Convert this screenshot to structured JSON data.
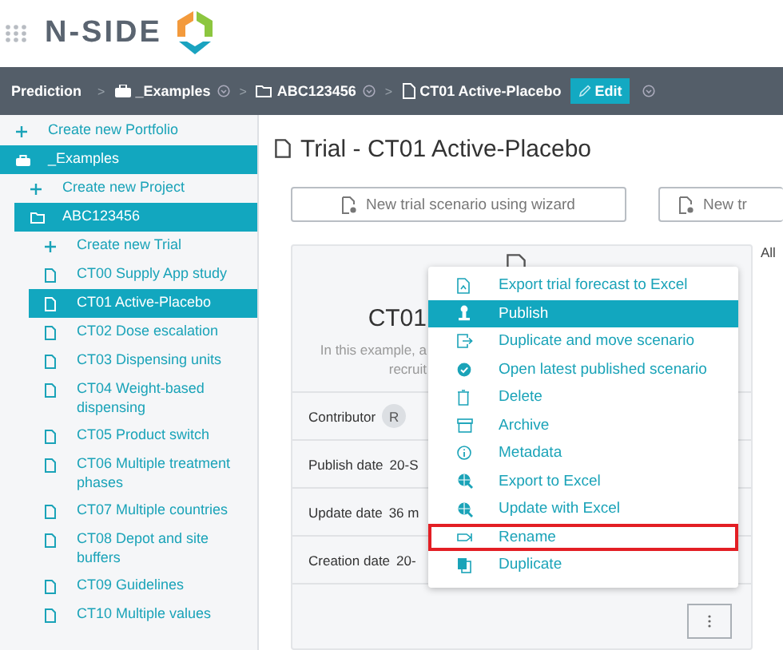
{
  "header": {
    "brand": "N-SIDE"
  },
  "breadcrumb": {
    "items": [
      {
        "label": "Prediction",
        "kind": "root"
      },
      {
        "label": "_Examples",
        "kind": "portfolio",
        "separator": ">"
      },
      {
        "label": "ABC123456",
        "kind": "project",
        "separator": ">"
      },
      {
        "label": "CT01 Active-Placebo",
        "kind": "trial",
        "separator": ">"
      }
    ],
    "edit_button": "Edit"
  },
  "sidebar": {
    "items": [
      {
        "label": "Create new Portfolio",
        "kind": "create",
        "selected": false
      },
      {
        "label": "_Examples",
        "kind": "portfolio",
        "selected": true,
        "children": [
          {
            "label": "Create new Project",
            "kind": "create",
            "selected": false
          },
          {
            "label": "ABC123456",
            "kind": "project",
            "selected": true,
            "children": [
              {
                "label": "Create new Trial",
                "kind": "create",
                "selected": false
              },
              {
                "label": "CT00 Supply App study",
                "kind": "trial",
                "selected": false
              },
              {
                "label": "CT01 Active-Placebo",
                "kind": "trial",
                "selected": true
              },
              {
                "label": "CT02 Dose escalation",
                "kind": "trial",
                "selected": false
              },
              {
                "label": "CT03 Dispensing units",
                "kind": "trial",
                "selected": false
              },
              {
                "label": "CT04 Weight-based dispensing",
                "kind": "trial",
                "selected": false
              },
              {
                "label": "CT05 Product switch",
                "kind": "trial",
                "selected": false
              },
              {
                "label": "CT06 Multiple treatment phases",
                "kind": "trial",
                "selected": false
              },
              {
                "label": "CT07 Multiple countries",
                "kind": "trial",
                "selected": false
              },
              {
                "label": "CT08 Depot and site buffers",
                "kind": "trial",
                "selected": false
              },
              {
                "label": "CT09 Guidelines",
                "kind": "trial",
                "selected": false
              },
              {
                "label": "CT10 Multiple values",
                "kind": "trial",
                "selected": false
              }
            ]
          }
        ]
      }
    ]
  },
  "main": {
    "title": "Trial - CT01 Active-Placebo",
    "buttons": [
      "New trial scenario using wizard",
      "New tr"
    ],
    "side_label": "All",
    "card": {
      "title": "CT01",
      "description_lines": [
        "In this example, a",
        "recruit"
      ],
      "fields": [
        {
          "label": "Contributor",
          "kind": "avatar",
          "value": "R"
        },
        {
          "label": "Publish date",
          "kind": "text",
          "value": "20-S"
        },
        {
          "label": "Update date",
          "kind": "text",
          "value": "36 m"
        },
        {
          "label": "Creation date",
          "kind": "text",
          "value": "20-"
        }
      ]
    }
  },
  "context_menu": {
    "items": [
      {
        "label": "Export trial forecast to Excel",
        "selected": false,
        "outlined": false
      },
      {
        "label": "Publish",
        "selected": true,
        "outlined": false
      },
      {
        "label": "Duplicate and move scenario",
        "selected": false,
        "outlined": false
      },
      {
        "label": "Open latest published scenario",
        "selected": false,
        "outlined": false
      },
      {
        "label": "Delete",
        "selected": false,
        "outlined": false
      },
      {
        "label": "Archive",
        "selected": false,
        "outlined": false
      },
      {
        "label": "Metadata",
        "selected": false,
        "outlined": false
      },
      {
        "label": "Export to Excel",
        "selected": false,
        "outlined": false
      },
      {
        "label": "Update with Excel",
        "selected": false,
        "outlined": false
      },
      {
        "label": "Rename",
        "selected": false,
        "outlined": true
      },
      {
        "label": "Duplicate",
        "selected": false,
        "outlined": false
      }
    ]
  }
}
